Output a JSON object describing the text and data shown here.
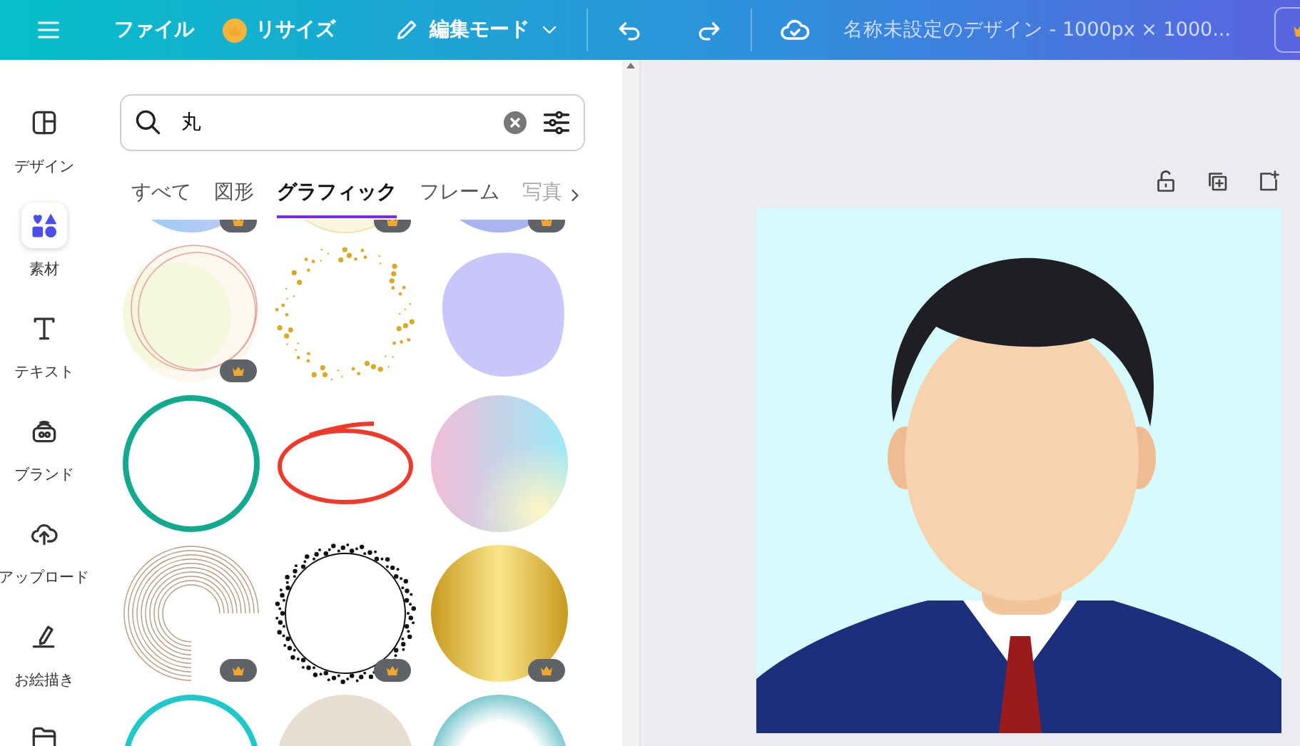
{
  "topbar": {
    "file": "ファイル",
    "resize": "リサイズ",
    "edit_mode": "編集モード",
    "title": "名称未設定のデザイン - 1000px × 1000..."
  },
  "sidebar": {
    "items": [
      {
        "kind": "design",
        "label": "デザイン",
        "selected": false
      },
      {
        "kind": "elements",
        "label": "素材",
        "selected": true
      },
      {
        "kind": "text",
        "label": "テキスト",
        "selected": false
      },
      {
        "kind": "brand",
        "label": "ブランド",
        "selected": false
      },
      {
        "kind": "upload",
        "label": "アップロード",
        "selected": false
      },
      {
        "kind": "draw",
        "label": "お絵描き",
        "selected": false
      },
      {
        "kind": "folder",
        "selected": false
      }
    ]
  },
  "search": {
    "value": "丸"
  },
  "tabs": [
    {
      "label": "すべて",
      "selected": false
    },
    {
      "label": "図形",
      "selected": false
    },
    {
      "label": "グラフィック",
      "selected": true
    },
    {
      "label": "フレーム",
      "selected": false
    },
    {
      "label": "写真",
      "selected": false
    }
  ],
  "graphics": [
    {
      "kind": "blue-disc",
      "premium": true
    },
    {
      "kind": "cream-disc",
      "premium": true
    },
    {
      "kind": "periwinkle-disc",
      "premium": true
    },
    {
      "kind": "cream-rings",
      "premium": true
    },
    {
      "kind": "gold-dust",
      "premium": false
    },
    {
      "kind": "lavender-blob",
      "premium": false
    },
    {
      "kind": "teal-ring",
      "premium": false
    },
    {
      "kind": "red-scribble",
      "premium": false
    },
    {
      "kind": "pastel-gradient",
      "premium": false
    },
    {
      "kind": "line-arcs",
      "premium": true
    },
    {
      "kind": "dotted-ring",
      "premium": true
    },
    {
      "kind": "gold-disc",
      "premium": true
    },
    {
      "kind": "cyan-ring"
    },
    {
      "kind": "beige-disc"
    },
    {
      "kind": "aqua-bubble"
    }
  ]
}
